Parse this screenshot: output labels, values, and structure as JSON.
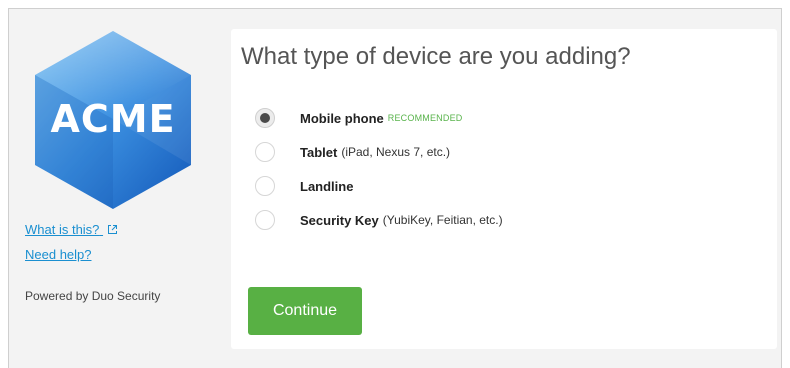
{
  "sidebar": {
    "logo_text": "ACME",
    "what_is_this_label": "What is this?",
    "need_help_label": "Need help?",
    "powered_by": "Powered by Duo Security"
  },
  "main": {
    "title": "What type of device are you adding?",
    "options": [
      {
        "label": "Mobile phone",
        "detail": "",
        "badge": "RECOMMENDED",
        "selected": true
      },
      {
        "label": "Tablet",
        "detail": "(iPad, Nexus 7, etc.)",
        "badge": "",
        "selected": false
      },
      {
        "label": "Landline",
        "detail": "",
        "badge": "",
        "selected": false
      },
      {
        "label": "Security Key",
        "detail": "(YubiKey, Feitian, etc.)",
        "badge": "",
        "selected": false
      }
    ],
    "continue_label": "Continue"
  },
  "colors": {
    "accent_green": "#58b044",
    "link_blue": "#1a8fd0",
    "logo_blue_light": "#5aa9e6",
    "logo_blue_dark": "#1565c0"
  }
}
